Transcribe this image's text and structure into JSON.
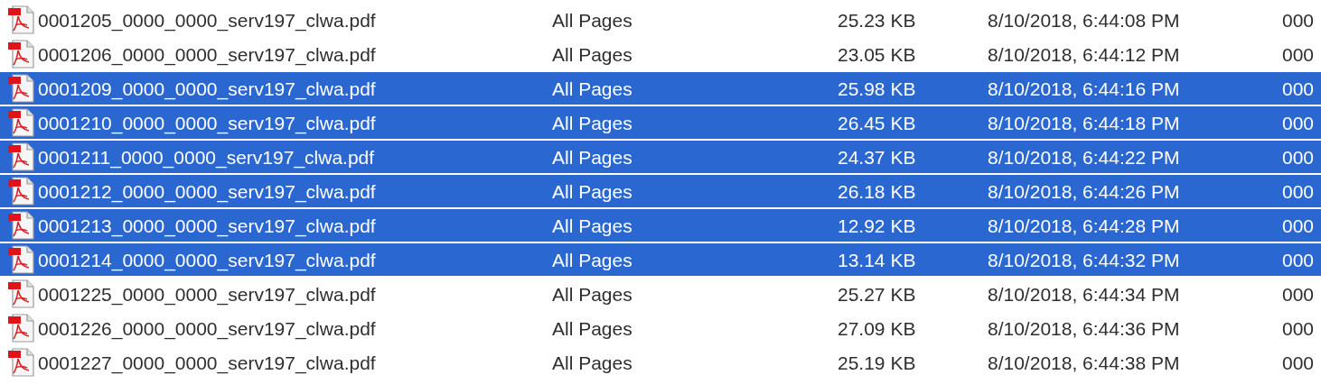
{
  "files": [
    {
      "name": "0001205_0000_0000_serv197_clwa.pdf",
      "kind": "All Pages",
      "size": "25.23 KB",
      "date": "8/10/2018, 6:44:08 PM",
      "column_5": "000",
      "selected": false
    },
    {
      "name": "0001206_0000_0000_serv197_clwa.pdf",
      "kind": "All Pages",
      "size": "23.05 KB",
      "date": "8/10/2018, 6:44:12 PM",
      "column_5": "000",
      "selected": false
    },
    {
      "name": "0001209_0000_0000_serv197_clwa.pdf",
      "kind": "All Pages",
      "size": "25.98 KB",
      "date": "8/10/2018, 6:44:16 PM",
      "column_5": "000",
      "selected": true
    },
    {
      "name": "0001210_0000_0000_serv197_clwa.pdf",
      "kind": "All Pages",
      "size": "26.45 KB",
      "date": "8/10/2018, 6:44:18 PM",
      "column_5": "000",
      "selected": true
    },
    {
      "name": "0001211_0000_0000_serv197_clwa.pdf",
      "kind": "All Pages",
      "size": "24.37 KB",
      "date": "8/10/2018, 6:44:22 PM",
      "column_5": "000",
      "selected": true
    },
    {
      "name": "0001212_0000_0000_serv197_clwa.pdf",
      "kind": "All Pages",
      "size": "26.18 KB",
      "date": "8/10/2018, 6:44:26 PM",
      "column_5": "000",
      "selected": true
    },
    {
      "name": "0001213_0000_0000_serv197_clwa.pdf",
      "kind": "All Pages",
      "size": "12.92 KB",
      "date": "8/10/2018, 6:44:28 PM",
      "column_5": "000",
      "selected": true
    },
    {
      "name": "0001214_0000_0000_serv197_clwa.pdf",
      "kind": "All Pages",
      "size": "13.14 KB",
      "date": "8/10/2018, 6:44:32 PM",
      "column_5": "000",
      "selected": true
    },
    {
      "name": "0001225_0000_0000_serv197_clwa.pdf",
      "kind": "All Pages",
      "size": "25.27 KB",
      "date": "8/10/2018, 6:44:34 PM",
      "column_5": "000",
      "selected": false
    },
    {
      "name": "0001226_0000_0000_serv197_clwa.pdf",
      "kind": "All Pages",
      "size": "27.09 KB",
      "date": "8/10/2018, 6:44:36 PM",
      "column_5": "000",
      "selected": false
    },
    {
      "name": "0001227_0000_0000_serv197_clwa.pdf",
      "kind": "All Pages",
      "size": "25.19 KB",
      "date": "8/10/2018, 6:44:38 PM",
      "column_5": "000",
      "selected": false
    }
  ]
}
